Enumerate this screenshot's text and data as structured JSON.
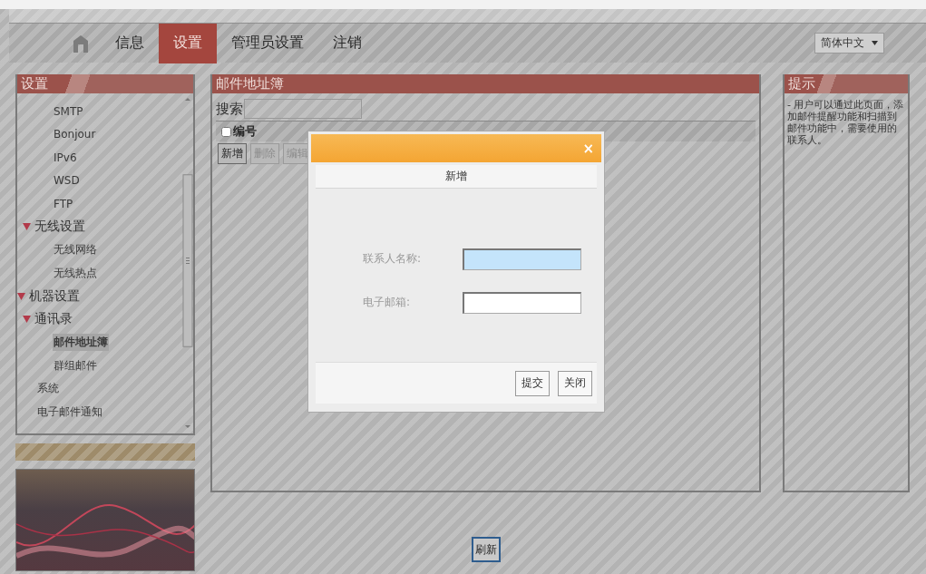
{
  "nav": {
    "items": [
      {
        "label": "信息",
        "selected": false
      },
      {
        "label": "设置",
        "selected": true
      },
      {
        "label": "管理员设置",
        "selected": false
      },
      {
        "label": "注销",
        "selected": false
      }
    ],
    "language": "简体中文"
  },
  "sidebar": {
    "title": "设置",
    "tree": [
      {
        "children": [
          {
            "children": [
              {
                "label": "SMTP",
                "selected": false
              },
              {
                "label": "Bonjour",
                "selected": false
              },
              {
                "label": "IPv6",
                "selected": false
              },
              {
                "label": "WSD",
                "selected": false
              },
              {
                "label": "FTP",
                "selected": false
              }
            ]
          },
          {
            "label": "无线设置",
            "expanded": true,
            "children": [
              {
                "label": "无线网络",
                "selected": false
              },
              {
                "label": "无线热点",
                "selected": false
              }
            ]
          }
        ]
      },
      {
        "label": "机器设置",
        "expanded": true,
        "children": [
          {
            "label": "通讯录",
            "expanded": true,
            "children": [
              {
                "label": "邮件地址簿",
                "selected": true
              },
              {
                "label": "群组邮件",
                "selected": false
              }
            ]
          },
          {
            "label": "系统",
            "selected": false
          },
          {
            "label": "电子邮件通知",
            "selected": false
          }
        ]
      }
    ]
  },
  "main": {
    "title": "邮件地址簿",
    "search_label": "搜索",
    "columns": [
      {
        "label": "编号",
        "checked": false
      }
    ],
    "buttons": [
      {
        "label": "新增",
        "disabled": false
      },
      {
        "label": "删除",
        "disabled": true
      },
      {
        "label": "编辑",
        "disabled": true
      }
    ],
    "refresh": "刷新"
  },
  "tip": {
    "title": "提示",
    "text": "- 用户可以通过此页面，添加邮件提醒功能和扫描到邮件功能中，需要使用的联系人。"
  },
  "dialog": {
    "close": "×",
    "title": "新增",
    "fields": [
      {
        "label": "联系人名称:",
        "focused": true
      },
      {
        "label": "电子邮箱:",
        "focused": false
      }
    ],
    "buttons": [
      "提交",
      "关闭"
    ]
  }
}
